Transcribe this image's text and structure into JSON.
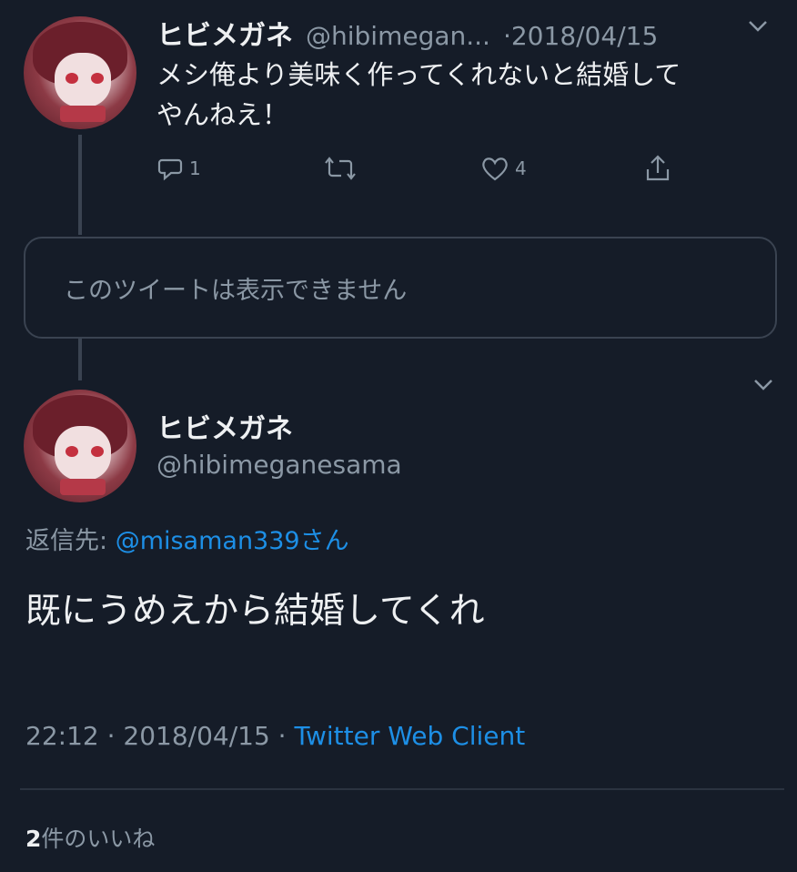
{
  "tweet1": {
    "name": "ヒビメガネ",
    "handle": "@hibimegan...",
    "date": "·2018/04/15",
    "text_line1": "メシ俺より美味く作ってくれないと結婚して",
    "text_line2": "やんねえ！",
    "reply_count": "1",
    "like_count": "4"
  },
  "unavailable": {
    "text": "このツイートは表示できません"
  },
  "tweet2": {
    "name": "ヒビメガネ",
    "handle": "@hibimeganesama",
    "reply_to_prefix": "返信先: ",
    "reply_to_handle": "@misaman339",
    "reply_to_suffix": "さん",
    "text": "既にうめえから結婚してくれ",
    "time": "22:12 · 2018/04/15 · ",
    "client": "Twitter Web Client",
    "likes_count": "2",
    "likes_label": "件のいいね"
  },
  "colors": {
    "background": "#151c28",
    "link": "#1d8fe6",
    "muted": "#8b98a5"
  }
}
